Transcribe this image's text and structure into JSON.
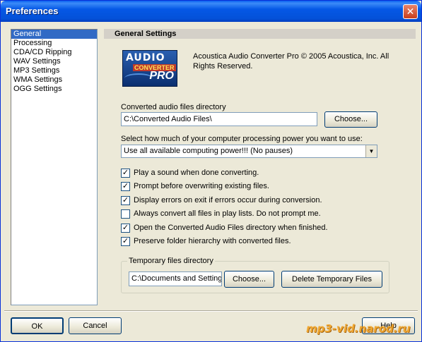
{
  "window": {
    "title": "Preferences",
    "close_glyph": "✕"
  },
  "sidebar": {
    "items": [
      {
        "label": "General",
        "selected": true
      },
      {
        "label": "Processing"
      },
      {
        "label": "CDA/CD Ripping"
      },
      {
        "label": "WAV Settings"
      },
      {
        "label": "MP3 Settings"
      },
      {
        "label": "WMA Settings"
      },
      {
        "label": "OGG Settings"
      }
    ]
  },
  "general": {
    "header": "General Settings",
    "logo": {
      "line1": "AUDIO",
      "line2": "CONVERTER",
      "line3": "PRO"
    },
    "copyright": "Acoustica Audio Converter Pro © 2005 Acoustica, Inc. All Rights Reserved.",
    "output_dir_label": "Converted audio files directory",
    "output_dir_value": "C:\\Converted Audio Files\\",
    "choose_label": "Choose...",
    "cpu_label": "Select how much of your computer processing power you want to use:",
    "cpu_value": "Use all available computing power!!! (No pauses)",
    "options": [
      {
        "label": "Play a sound when done converting.",
        "checked": true
      },
      {
        "label": "Prompt before overwriting existing files.",
        "checked": true
      },
      {
        "label": "Display errors on exit if errors occur during conversion.",
        "checked": true
      },
      {
        "label": "Always convert all files in play lists.  Do not prompt me.",
        "checked": false
      },
      {
        "label": "Open the Converted Audio Files directory when finished.",
        "checked": true
      },
      {
        "label": "Preserve folder hierarchy with converted files.",
        "checked": true
      }
    ],
    "temp_group_label": "Temporary files directory",
    "temp_dir_value": "C:\\Documents and Setting",
    "temp_choose_label": "Choose...",
    "delete_temp_label": "Delete Temporary Files"
  },
  "footer": {
    "ok_label": "OK",
    "cancel_label": "Cancel",
    "help_label": "Help"
  },
  "watermark": "mp3-vid.narod.ru",
  "colors": {
    "title_bar": "#0558e6",
    "selection": "#316ac5",
    "dialog_bg": "#ece9d8",
    "close": "#c93e1c"
  }
}
